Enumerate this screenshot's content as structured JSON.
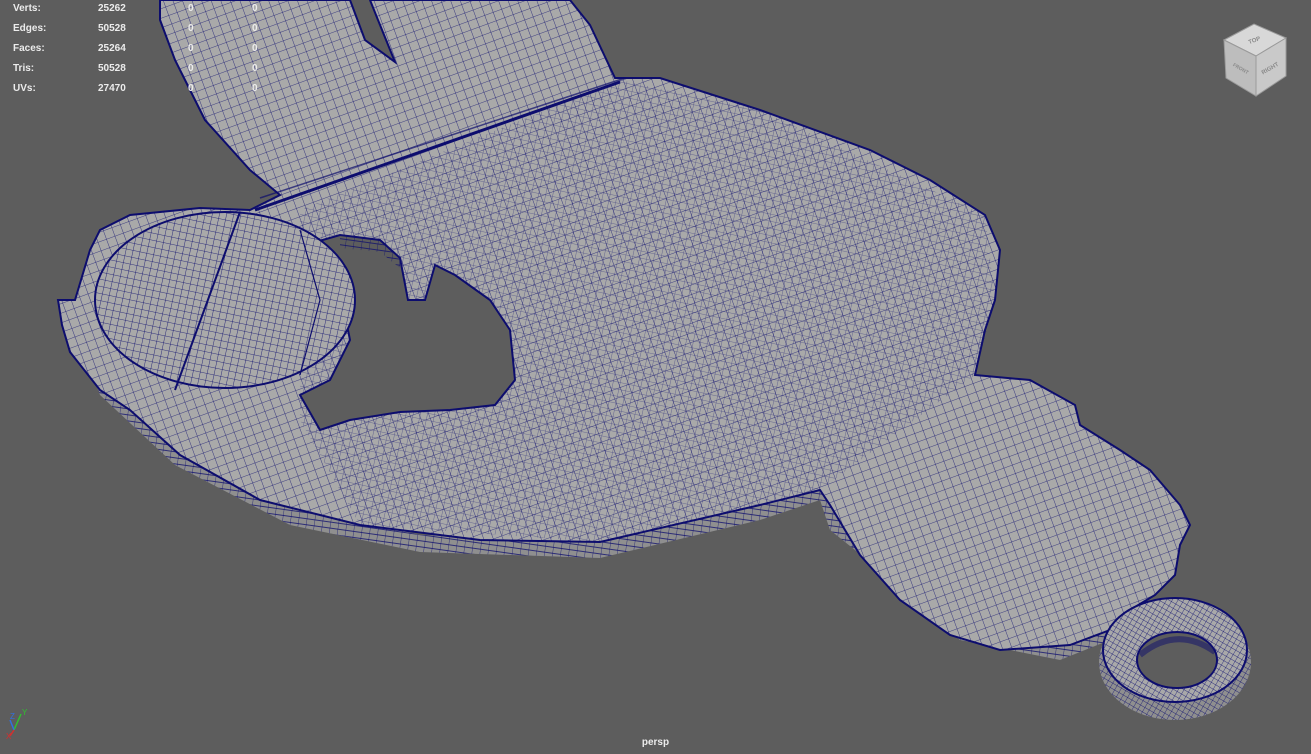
{
  "hud": {
    "rows": [
      {
        "label": "Verts:",
        "value": "25262",
        "selected": "0",
        "component": "0"
      },
      {
        "label": "Edges:",
        "value": "50528",
        "selected": "0",
        "component": "0"
      },
      {
        "label": "Faces:",
        "value": "25264",
        "selected": "0",
        "component": "0"
      },
      {
        "label": "Tris:",
        "value": "50528",
        "selected": "0",
        "component": "0"
      },
      {
        "label": "UVs:",
        "value": "27470",
        "selected": "0",
        "component": "0"
      }
    ]
  },
  "camera": {
    "name": "persp"
  },
  "viewcube": {
    "top_face": "TOP",
    "front_face": "FRONT",
    "right_face": "RIGHT"
  },
  "axis": {
    "x": "X",
    "y": "Y",
    "z": "Z"
  },
  "colors": {
    "background": "#5d5d5d",
    "mesh_fill": "#a9a9a9",
    "mesh_side": "#8f8f8f",
    "wireframe": "#0d0d6e",
    "hud_text": "#ececec",
    "axis_x": "#d23030",
    "axis_y": "#30c030",
    "axis_z": "#3070e0"
  },
  "icons": [
    "view-cube-icon",
    "axis-gizmo-icon"
  ]
}
